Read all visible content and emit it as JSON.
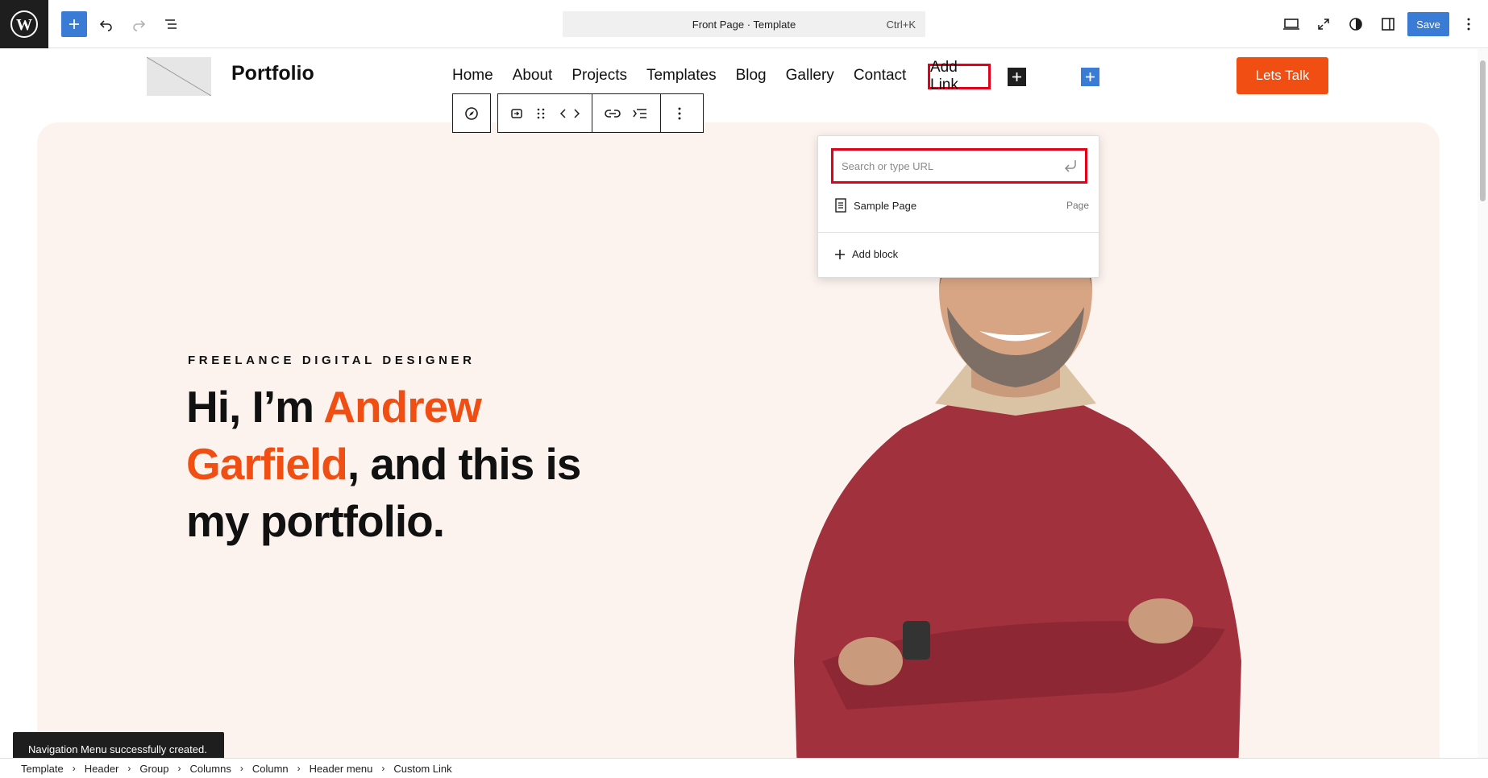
{
  "topbar": {
    "logo_icon": "wordpress-logo-icon",
    "document_title": "Front Page · Template",
    "shortcut": "Ctrl+K",
    "save_label": "Save",
    "accent": "#3a7bd5"
  },
  "site": {
    "title": "Portfolio",
    "nav": [
      "Home",
      "About",
      "Projects",
      "Templates",
      "Blog",
      "Gallery",
      "Contact"
    ],
    "add_link_label": "Add Link",
    "cta_label": "Lets Talk",
    "brand_color": "#f04e13"
  },
  "hero": {
    "eyebrow": "FREELANCE DIGITAL DESIGNER",
    "headline_pre": "Hi, I’m ",
    "headline_name1": "Andrew",
    "headline_name2": "Garfield",
    "headline_post1": ", and this is",
    "headline_post2": "my portfolio."
  },
  "link_popover": {
    "placeholder": "Search or type URL",
    "suggestion_title": "Sample Page",
    "suggestion_kind": "Page",
    "add_block_label": "Add block"
  },
  "snackbar": {
    "message": "Navigation Menu successfully created."
  },
  "breadcrumb": [
    "Template",
    "Header",
    "Group",
    "Columns",
    "Column",
    "Header menu",
    "Custom Link"
  ]
}
